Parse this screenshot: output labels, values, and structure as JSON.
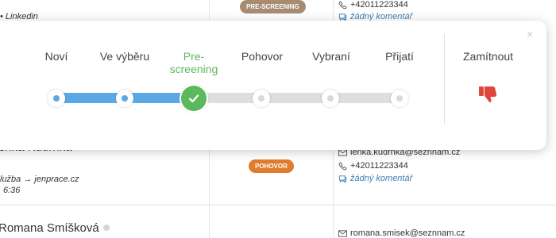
{
  "candidates": [
    {
      "name": "",
      "source": "Linkedin",
      "badge": "PRE-SCREENING",
      "badge_color": "#a88c72",
      "phone": "+42011223344",
      "comment": "žádný komentář"
    },
    {
      "name": "enka Kudrnka",
      "source": "lužba → jenprace.cz",
      "time": "6:36",
      "badge": "POHOVOR",
      "badge_color": "#e07c2d",
      "email": "lenka.kudrnka@seznnam.cz",
      "phone": "+42011223344",
      "comment": "žádný komentář"
    },
    {
      "name": "Romana Smíšková",
      "email": "romana.smisek@seznnam.cz"
    }
  ],
  "pipeline": {
    "stages": [
      {
        "label": "Noví",
        "state": "done"
      },
      {
        "label": "Ve výběru",
        "state": "done"
      },
      {
        "label": "Pre-screening",
        "state": "active"
      },
      {
        "label": "Pohovor",
        "state": "todo"
      },
      {
        "label": "Vybraní",
        "state": "todo"
      },
      {
        "label": "Přijatí",
        "state": "todo"
      }
    ],
    "reject_label": "Zamítnout",
    "close_icon": "×",
    "colors": {
      "done": "#5aa9e6",
      "active": "#5cb85c",
      "todo": "#dedede",
      "reject": "#e0453a"
    }
  }
}
